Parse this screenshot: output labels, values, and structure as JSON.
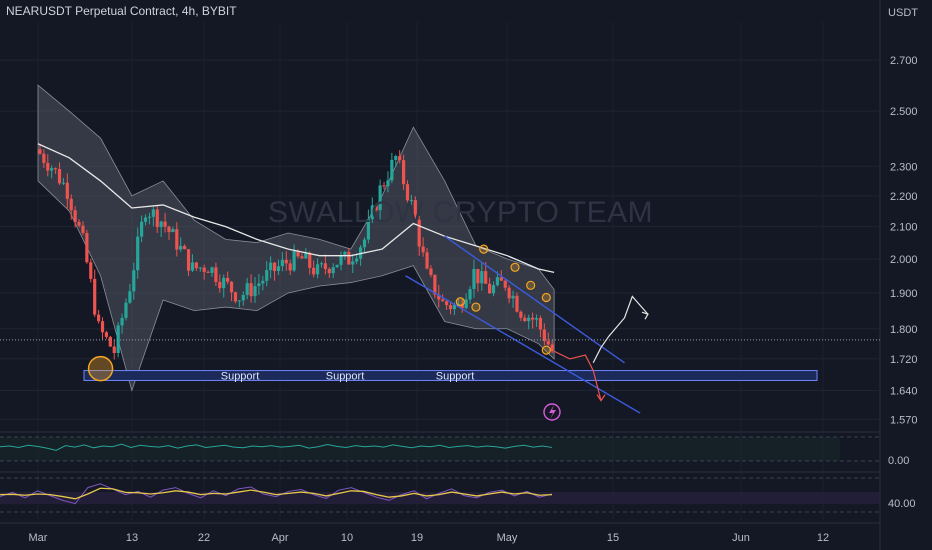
{
  "header": {
    "title": "NEARUSDT Perpetual Contract, 4h, BYBIT",
    "currency": "USDT",
    "watermark": "SWALLOW CRYPTO TEAM"
  },
  "colors": {
    "background": "#141824",
    "bull": "#26a69a",
    "bear": "#ef5350",
    "band_fill": "#5d626e",
    "ma": "#e8e8e8",
    "support_fill": "#1b2a58",
    "support_border": "#6f86ff",
    "channel": "#3b5bdb",
    "orange": "#f5a623",
    "projection_red": "#ef5350",
    "projection_white": "#e6e6e6",
    "rsi": "#26a69a",
    "stoch_k": "#7e57c2",
    "stoch_d": "#e6c84a",
    "lightning": "#d55bd8"
  },
  "chart_data": [
    {
      "type": "line",
      "title": "NEARUSDT Perpetual Contract, 4h, BYBIT",
      "yscale": "log",
      "ylim": [
        1.545,
        2.86
      ],
      "y_ticks": [
        "2.700",
        "2.500",
        "2.300",
        "2.200",
        "2.100",
        "2.000",
        "1.900",
        "1.800",
        "1.720",
        "1.640",
        "1.570"
      ],
      "x_ticks": [
        "Mar",
        "13",
        "22",
        "Apr",
        "10",
        "19",
        "May",
        "15",
        "Jun",
        "12"
      ],
      "grid": true,
      "current_price": 1.77,
      "series": [
        {
          "type": "candlestick",
          "x": [
            "Mar 1",
            "Mar 3",
            "Mar 5",
            "Mar 7",
            "Mar 9",
            "Mar 11",
            "Mar 13",
            "Mar 15",
            "Mar 17",
            "Mar 19",
            "Mar 21",
            "Mar 23",
            "Mar 25",
            "Mar 27",
            "Mar 29",
            "Mar 31",
            "Apr 2",
            "Apr 4",
            "Apr 6",
            "Apr 8",
            "Apr 10",
            "Apr 12",
            "Apr 14",
            "Apr 16",
            "Apr 18",
            "Apr 20",
            "Apr 22",
            "Apr 24",
            "Apr 26",
            "Apr 28",
            "Apr 30",
            "May 2",
            "May 4",
            "May 6"
          ],
          "close": [
            2.36,
            2.3,
            2.22,
            2.05,
            1.8,
            1.74,
            1.92,
            2.16,
            2.12,
            2.05,
            1.97,
            1.98,
            1.93,
            1.89,
            1.92,
            1.96,
            1.99,
            2.0,
            1.96,
            1.99,
            2.0,
            2.06,
            2.22,
            2.33,
            2.17,
            1.95,
            1.87,
            1.86,
            1.96,
            1.91,
            1.93,
            1.85,
            1.82,
            1.74
          ]
        },
        {
          "name": "",
          "type": "line",
          "x": [
            "Mar 1",
            "Mar 5",
            "Mar 9",
            "Mar 13",
            "Mar 17",
            "Mar 21",
            "Mar 25",
            "Mar 29",
            "Apr 2",
            "Apr 6",
            "Apr 10",
            "Apr 14",
            "Apr 18",
            "Apr 22",
            "Apr 26",
            "Apr 30",
            "May 4",
            "May 6"
          ],
          "values": [
            2.38,
            2.33,
            2.25,
            2.16,
            2.17,
            2.13,
            2.1,
            2.06,
            2.03,
            2.01,
            2.01,
            2.03,
            2.11,
            2.07,
            2.04,
            2.01,
            1.97,
            1.96
          ]
        }
      ],
      "bands": {
        "upper": [
          2.6,
          2.5,
          2.4,
          2.2,
          2.25,
          2.12,
          2.06,
          2.05,
          2.08,
          2.06,
          2.03,
          2.2,
          2.44,
          2.25,
          2.04,
          2.0,
          1.97,
          1.91
        ],
        "lower": [
          2.25,
          2.15,
          1.95,
          1.64,
          1.88,
          1.85,
          1.86,
          1.85,
          1.9,
          1.92,
          1.93,
          1.95,
          1.98,
          1.82,
          1.8,
          1.8,
          1.76,
          1.72
        ]
      },
      "support_zone": {
        "low": 1.665,
        "high": 1.69,
        "labels": [
          "Support",
          "Support",
          "Support"
        ]
      },
      "channel": {
        "upper": {
          "from": [
            "Apr 22",
            2.07
          ],
          "to": [
            "May 15",
            1.71
          ]
        },
        "lower": {
          "from": [
            "Apr 17",
            1.95
          ],
          "to": [
            "May 17",
            1.585
          ]
        }
      },
      "projections": {
        "bearish": [
          [
            "May 6",
            1.74
          ],
          [
            "May 8",
            1.72
          ],
          [
            "May 10",
            1.73
          ],
          [
            "May 11",
            1.69
          ],
          [
            "May 12",
            1.615
          ]
        ],
        "bullish": [
          [
            "May 11",
            1.71
          ],
          [
            "May 12",
            1.75
          ],
          [
            "May 13",
            1.78
          ],
          [
            "May 15",
            1.83
          ],
          [
            "May 16",
            1.89
          ],
          [
            "May 18",
            1.84
          ]
        ]
      },
      "markers": [
        {
          "x": "Mar 9",
          "y": 1.695
        },
        {
          "x": "Apr 24",
          "y": 1.875
        },
        {
          "x": "Apr 26",
          "y": 1.86
        },
        {
          "x": "Apr 27",
          "y": 2.03
        },
        {
          "x": "May 1",
          "y": 1.975
        },
        {
          "x": "May 3",
          "y": 1.922
        },
        {
          "x": "May 5",
          "y": 1.887
        },
        {
          "x": "May 5",
          "y": 1.743
        }
      ]
    },
    {
      "type": "line",
      "ylim": [
        0,
        100
      ],
      "y_ticks": [
        "0.00"
      ],
      "series": [
        {
          "name": "",
          "values": [
            48,
            50,
            46,
            52,
            49,
            44,
            38,
            51,
            47,
            53,
            45,
            50,
            48,
            55,
            46,
            52,
            49,
            47,
            51,
            44,
            50,
            53,
            46,
            49,
            52,
            47,
            45,
            50,
            48,
            51,
            47,
            49,
            52,
            44,
            48,
            54,
            49,
            46,
            51,
            48,
            50,
            47,
            53,
            49,
            45,
            50,
            48,
            52,
            46,
            49,
            51,
            47,
            50,
            48,
            44,
            49,
            52,
            47,
            50,
            46
          ]
        }
      ]
    },
    {
      "type": "line",
      "ylim": [
        0,
        100
      ],
      "y_ticks": [
        "40.00"
      ],
      "series": [
        {
          "name": "",
          "values": [
            42,
            55,
            38,
            60,
            45,
            30,
            20,
            70,
            82,
            65,
            48,
            58,
            40,
            62,
            70,
            52,
            38,
            60,
            45,
            66,
            72,
            50,
            42,
            58,
            64,
            48,
            36,
            62,
            70,
            55,
            40,
            30,
            48,
            60,
            35,
            52,
            66,
            45,
            38,
            55,
            62,
            44,
            58,
            40,
            50
          ]
        },
        {
          "name": "",
          "values": [
            48,
            49,
            46,
            50,
            48,
            42,
            35,
            50,
            68,
            66,
            55,
            54,
            50,
            54,
            60,
            56,
            48,
            52,
            50,
            56,
            62,
            56,
            48,
            52,
            56,
            52,
            44,
            52,
            60,
            58,
            48,
            40,
            44,
            52,
            44,
            48,
            56,
            50,
            44,
            50,
            56,
            50,
            54,
            46,
            48
          ]
        }
      ]
    }
  ]
}
